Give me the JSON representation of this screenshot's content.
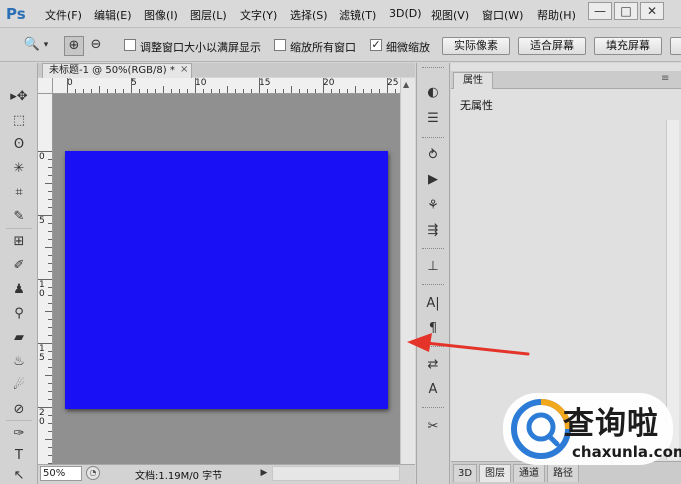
{
  "app": {
    "logo": "Ps",
    "menu": [
      "文件(F)",
      "编辑(E)",
      "图像(I)",
      "图层(L)",
      "文字(Y)",
      "选择(S)",
      "滤镜(T)",
      "3D(D)",
      "视图(V)",
      "窗口(W)",
      "帮助(H)"
    ],
    "window_controls": [
      "—",
      "□",
      "✕"
    ]
  },
  "options_bar": {
    "zoom_tool_icon": "🔍",
    "zoom_dropdown_icon": "▾",
    "zoom_in_icon": "⊕",
    "zoom_out_icon": "⊖",
    "checkboxes": [
      {
        "label": "调整窗口大小以满屏显示",
        "checked": false
      },
      {
        "label": "缩放所有窗口",
        "checked": false
      },
      {
        "label": "细微缩放",
        "checked": true
      }
    ],
    "buttons": [
      "实际像素",
      "适合屏幕",
      "填充屏幕"
    ]
  },
  "document": {
    "tab_title": "未标题-1 @ 50%(RGB/8) *",
    "close_icon": "×",
    "canvas_color": "#1a10f6",
    "ruler_h_labels": [
      "0",
      "5",
      "10",
      "15",
      "20",
      "25"
    ],
    "ruler_v_labels": [
      "0",
      "5",
      "1\n0",
      "1\n5",
      "2\n0"
    ],
    "zoom": "50%",
    "doc_info": "文档:1.19M/0 字节",
    "status_arrow": "▶"
  },
  "tools": [
    "▸✥",
    "⬚",
    "ʘ",
    "✳",
    "⌗",
    "✎",
    "⊞",
    "✐",
    "♟",
    "⚲",
    "▰",
    "♨",
    "☄",
    "⊘",
    "✑",
    "T",
    "↖"
  ],
  "dock_icons": [
    "◐",
    "☰",
    "⥁",
    "▶",
    "⚘",
    "⇶",
    "⊥",
    "A|",
    "¶",
    "⇄",
    "A",
    "✂"
  ],
  "properties_panel": {
    "tab_label": "属性",
    "menu_icon": "≡",
    "content": "无属性"
  },
  "bottom_tabs": [
    "3D",
    "图层",
    "通道",
    "路径"
  ],
  "watermark": {
    "title": "查询啦",
    "url": "chaxunla.com"
  }
}
